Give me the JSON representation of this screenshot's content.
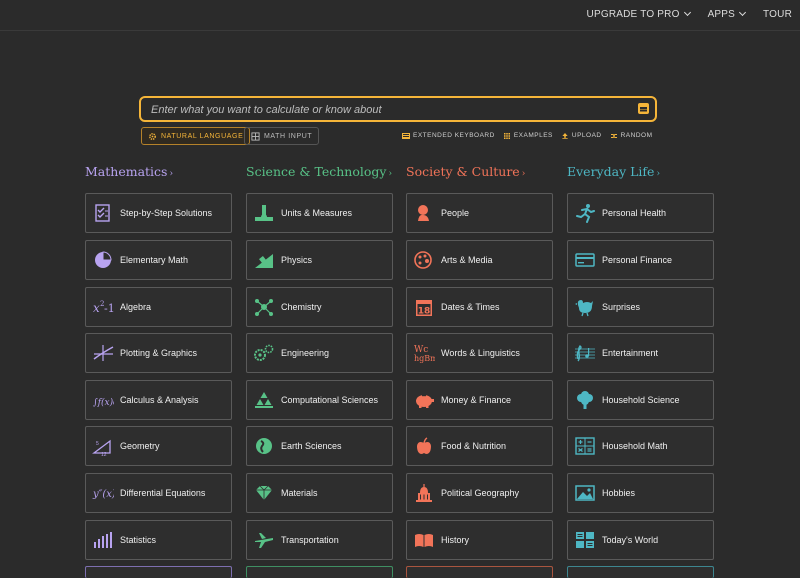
{
  "nav": {
    "upgrade": "UPGRADE TO PRO",
    "apps": "APPS",
    "tour": "TOUR"
  },
  "search": {
    "placeholder": "Enter what you want to calculate or know about"
  },
  "modes": {
    "natural": "NATURAL LANGUAGE",
    "math": "MATH INPUT"
  },
  "options": {
    "keyboard": "EXTENDED KEYBOARD",
    "examples": "EXAMPLES",
    "upload": "UPLOAD",
    "random": "RANDOM"
  },
  "colors": {
    "accent": "#f5b539",
    "math": "#b8a3f0",
    "science": "#58c287",
    "society": "#f27459",
    "everyday": "#4eb7c4"
  },
  "columns": [
    {
      "title": "Mathematics",
      "arrow": "›",
      "items": [
        "Step-by-Step Solutions",
        "Elementary Math",
        "Algebra",
        "Plotting & Graphics",
        "Calculus & Analysis",
        "Geometry",
        "Differential Equations",
        "Statistics"
      ]
    },
    {
      "title": "Science & Technology",
      "arrow": "›",
      "items": [
        "Units & Measures",
        "Physics",
        "Chemistry",
        "Engineering",
        "Computational Sciences",
        "Earth Sciences",
        "Materials",
        "Transportation"
      ]
    },
    {
      "title": "Society & Culture",
      "arrow": "›",
      "items": [
        "People",
        "Arts & Media",
        "Dates & Times",
        "Words & Linguistics",
        "Money & Finance",
        "Food & Nutrition",
        "Political Geography",
        "History"
      ]
    },
    {
      "title": "Everyday Life",
      "arrow": "›",
      "items": [
        "Personal Health",
        "Personal Finance",
        "Surprises",
        "Entertainment",
        "Household Science",
        "Household Math",
        "Hobbies",
        "Today's World"
      ]
    }
  ]
}
